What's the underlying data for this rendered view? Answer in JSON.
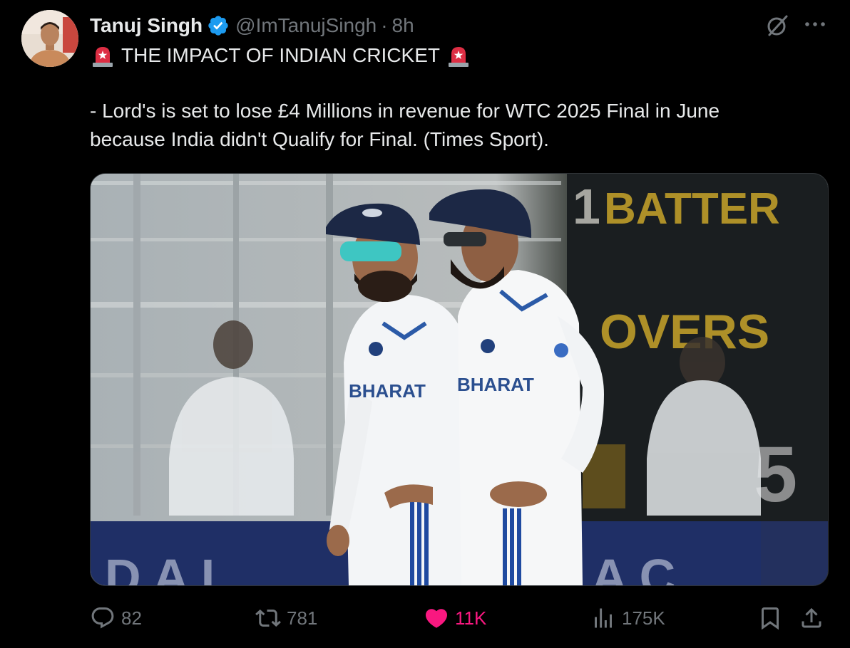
{
  "tweet": {
    "display_name": "Tanuj Singh",
    "handle": "@ImTanujSingh",
    "separator": "·",
    "time": "8h",
    "line1": "THE IMPACT OF INDIAN CRICKET",
    "line3": "- Lord's is set to lose £4 Millions in revenue for WTC 2025 Final in June",
    "line4": "because India didn't Qualify for Final. (Times Sport).",
    "emoji": "rotating-light-icon"
  },
  "media": {
    "scoreboard_1": "1",
    "scoreboard_2": "BATTER",
    "scoreboard_3": "OVERS",
    "scoreboard_4": "5",
    "jersey_text": "BHARAT"
  },
  "actions": {
    "replies": "82",
    "reposts": "781",
    "likes": "11K",
    "views": "175K"
  },
  "colors": {
    "background": "#000000",
    "text": "#e7e9ea",
    "muted": "#71767b",
    "like": "#f91880",
    "verified": "#1d9bf0"
  }
}
